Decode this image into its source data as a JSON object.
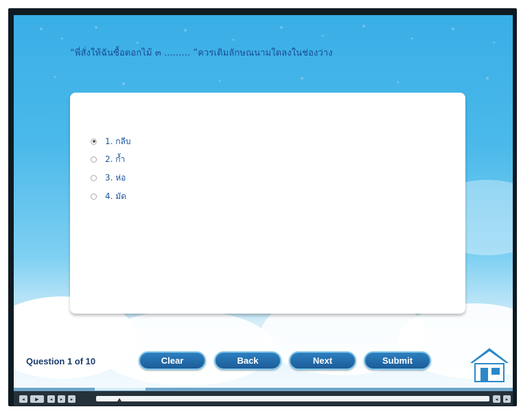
{
  "question": {
    "text": "“พี่สั่งให้ฉันซื้อดอกไม้ ๓ ......... ”ควรเติมลักษณนามใดลงในช่องว่าง"
  },
  "options": [
    {
      "label": "1. กลีบ",
      "selected": true
    },
    {
      "label": "2. ก้ำ",
      "selected": false
    },
    {
      "label": "3. ห่อ",
      "selected": false
    },
    {
      "label": "4. มัด",
      "selected": false
    }
  ],
  "footer": {
    "counter": "Question 1 of 10",
    "buttons": {
      "clear": "Clear",
      "back": "Back",
      "next": "Next",
      "submit": "Submit"
    }
  },
  "icons": {
    "home": "home-icon",
    "play": "play-icon",
    "rewind": "rewind-icon",
    "forward": "forward-icon"
  },
  "colors": {
    "sky": "#39aee6",
    "button": "#1c5c98",
    "question_text": "#1b4a92",
    "option_text": "#1d55a0"
  },
  "player": {
    "progress": 0.05
  }
}
